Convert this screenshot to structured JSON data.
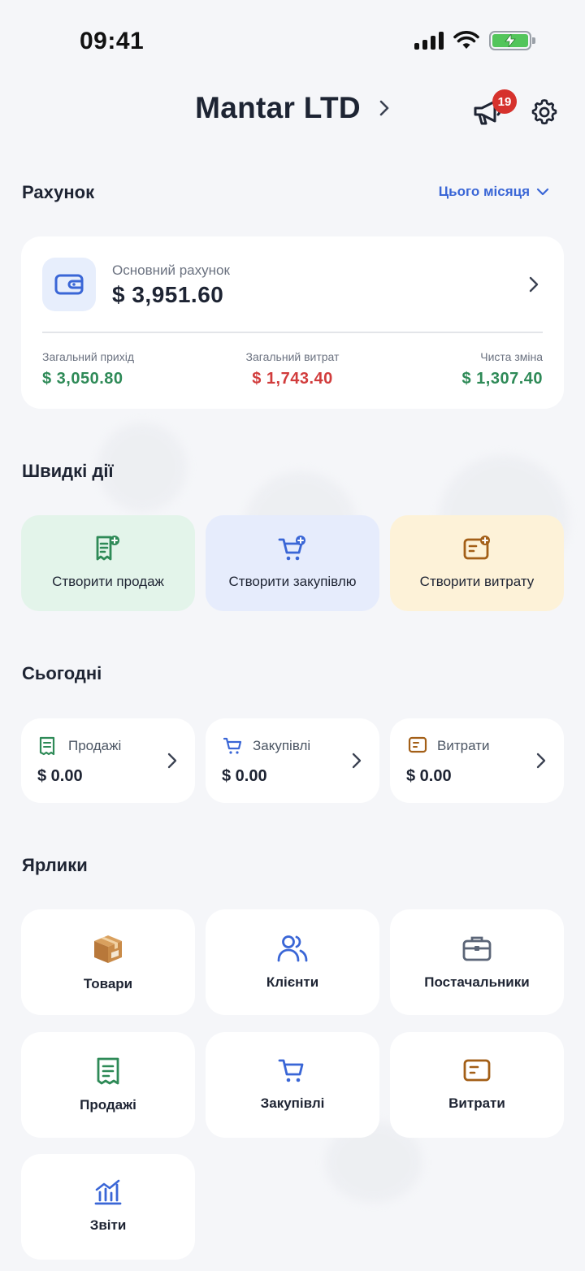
{
  "status_bar": {
    "time": "09:41"
  },
  "header": {
    "company_name": "Mantar LTD",
    "notification_count": "19"
  },
  "account_section": {
    "title": "Рахунок",
    "period": "Цього місяця",
    "account_label": "Основний рахунок",
    "balance": "$ 3,951.60",
    "income_label": "Загальний прихід",
    "income_value": "$ 3,050.80",
    "expense_label": "Загальний витрат",
    "expense_value": "$ 1,743.40",
    "net_label": "Чиста зміна",
    "net_value": "$ 1,307.40"
  },
  "quick_actions": {
    "title": "Швидкі дії",
    "items": [
      {
        "label": "Створити продаж",
        "icon": "receipt-plus-icon",
        "color": "#2e8a57",
        "bg": "#e3f4ea"
      },
      {
        "label": "Створити закупівлю",
        "icon": "cart-plus-icon",
        "color": "#3a66d6",
        "bg": "#e6ecfc"
      },
      {
        "label": "Створити витрату",
        "icon": "note-plus-icon",
        "color": "#a35f17",
        "bg": "#fdf2d8"
      }
    ]
  },
  "today": {
    "title": "Сьогодні",
    "items": [
      {
        "label": "Продажі",
        "value": "$ 0.00"
      },
      {
        "label": "Закупівлі",
        "value": "$ 0.00"
      },
      {
        "label": "Витрати",
        "value": "$ 0.00"
      }
    ]
  },
  "shortcuts": {
    "title": "Ярлики",
    "items": [
      {
        "label": "Товари",
        "icon": "package-icon"
      },
      {
        "label": "Клієнти",
        "icon": "users-icon"
      },
      {
        "label": "Постачальники",
        "icon": "briefcase-icon"
      },
      {
        "label": "Продажі",
        "icon": "receipt-icon"
      },
      {
        "label": "Закупівлі",
        "icon": "cart-icon"
      },
      {
        "label": "Витрати",
        "icon": "note-icon"
      },
      {
        "label": "Звіти",
        "icon": "chart-icon"
      }
    ]
  },
  "colors": {
    "accent": "#3a66d6",
    "green": "#2e8a57",
    "red": "#d13c3c",
    "brown": "#a35f17"
  }
}
